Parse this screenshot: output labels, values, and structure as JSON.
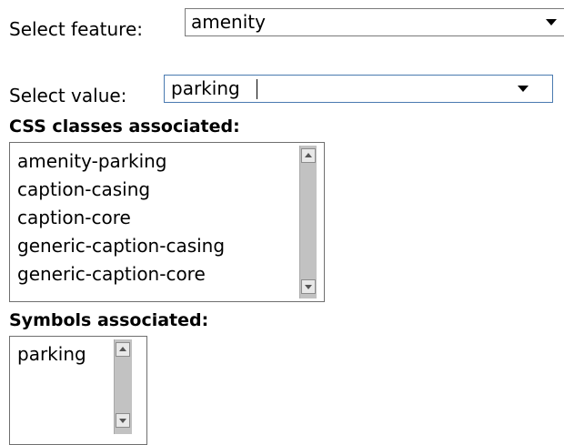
{
  "feature": {
    "label": "Select feature:",
    "value": "amenity"
  },
  "value_select": {
    "label": "Select value:",
    "value": "parking"
  },
  "css_classes": {
    "heading": "CSS classes associated:",
    "items": [
      "amenity-parking",
      "caption-casing",
      "caption-core",
      "generic-caption-casing",
      "generic-caption-core"
    ]
  },
  "symbols": {
    "heading": "Symbols associated:",
    "items": [
      "parking"
    ]
  }
}
